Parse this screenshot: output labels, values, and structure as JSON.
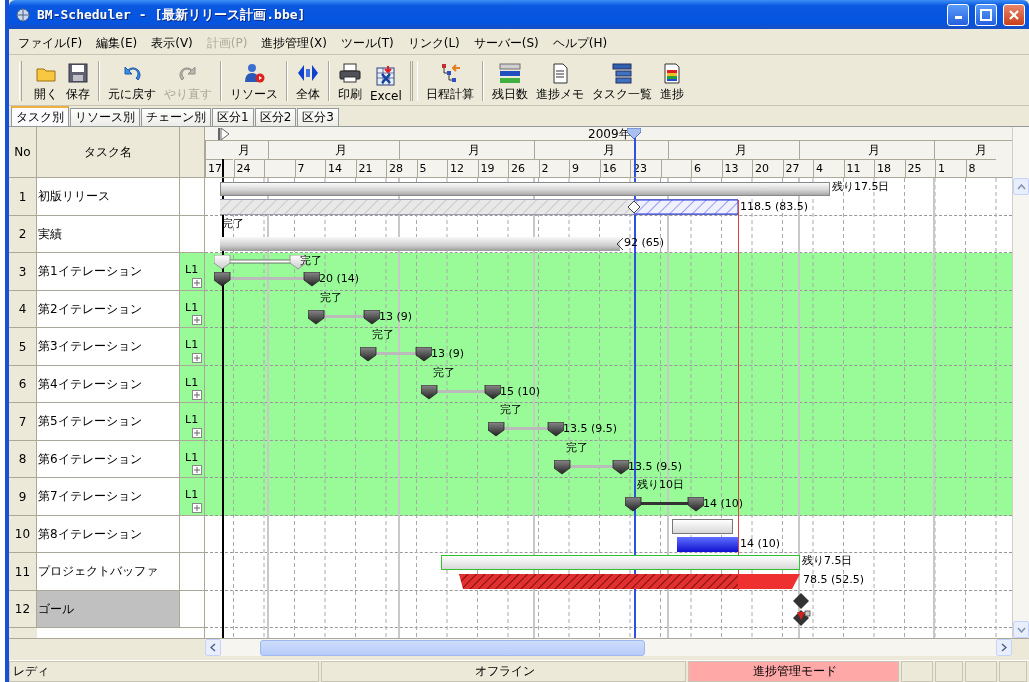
{
  "window": {
    "title": "BM-Scheduler - [最新リリース計画.bbe]"
  },
  "menu": [
    {
      "label": "ファイル(F)",
      "disabled": false
    },
    {
      "label": "編集(E)",
      "disabled": false
    },
    {
      "label": "表示(V)",
      "disabled": false
    },
    {
      "label": "計画(P)",
      "disabled": true
    },
    {
      "label": "進捗管理(X)",
      "disabled": false
    },
    {
      "label": "ツール(T)",
      "disabled": false
    },
    {
      "label": "リンク(L)",
      "disabled": false
    },
    {
      "label": "サーバー(S)",
      "disabled": false
    },
    {
      "label": "ヘルプ(H)",
      "disabled": false
    }
  ],
  "toolbar": [
    [
      {
        "label": "開く",
        "disabled": false
      },
      {
        "label": "保存",
        "disabled": false
      }
    ],
    [
      {
        "label": "元に戻す",
        "disabled": false
      },
      {
        "label": "やり直す",
        "disabled": true
      }
    ],
    [
      {
        "label": "リソース",
        "disabled": false
      }
    ],
    [
      {
        "label": "全体",
        "disabled": false
      }
    ],
    [
      {
        "label": "印刷",
        "disabled": false
      },
      {
        "label": "Excel",
        "disabled": false
      }
    ],
    [
      {
        "label": "日程計算",
        "disabled": false
      }
    ],
    [
      {
        "label": "残日数",
        "disabled": false
      },
      {
        "label": "進捗メモ",
        "disabled": false
      },
      {
        "label": "タスク一覧",
        "disabled": false
      },
      {
        "label": "進捗",
        "disabled": false
      }
    ]
  ],
  "tabs": [
    {
      "label": "タスク別",
      "selected": true
    },
    {
      "label": "リソース別",
      "selected": false
    },
    {
      "label": "チェーン別",
      "selected": false
    },
    {
      "label": "区分1",
      "selected": false
    },
    {
      "label": "区分2",
      "selected": false
    },
    {
      "label": "区分3",
      "selected": false
    }
  ],
  "grid": {
    "columns": [
      "No",
      "タスク名"
    ]
  },
  "timeline": {
    "year": "2009年",
    "months": [
      {
        "label": "月",
        "days": [
          "17",
          "24"
        ]
      },
      {
        "label": "月",
        "days": [
          "7",
          "14",
          "21",
          "28"
        ]
      },
      {
        "label": "月",
        "days": [
          "5",
          "12",
          "19",
          "26"
        ]
      },
      {
        "label": "月",
        "days": [
          "2",
          "9",
          "16",
          "23"
        ]
      },
      {
        "label": "月",
        "days": [
          "6",
          "13",
          "20",
          "27"
        ]
      },
      {
        "label": "月",
        "days": [
          "4",
          "11",
          "18",
          "25"
        ]
      },
      {
        "label": "月",
        "days": [
          "1",
          "8"
        ]
      }
    ]
  },
  "rows": [
    {
      "no": "1",
      "name": "初版リリース",
      "kind": "summary",
      "selected": false,
      "highlighted": false,
      "level": 0.8,
      "status": "残り17.5日",
      "value": "118.5 (83.5)"
    },
    {
      "no": "2",
      "name": "実績",
      "kind": "actual",
      "selected": false,
      "highlighted": false,
      "status": "完了",
      "value": "92 (65)"
    },
    {
      "no": "3",
      "name": "第1イテレーション",
      "kind": "first_iteration",
      "group": "L1",
      "selected": false,
      "highlighted": true,
      "status": "完了",
      "value": "20 (14)"
    },
    {
      "no": "4",
      "name": "第2イテレーション",
      "kind": "iteration",
      "group": "L1",
      "selected": false,
      "highlighted": true,
      "status": "完了",
      "value": "13 (9)"
    },
    {
      "no": "5",
      "name": "第3イテレーション",
      "kind": "iteration",
      "group": "L1",
      "selected": false,
      "highlighted": true,
      "status": "完了",
      "value": "13 (9)"
    },
    {
      "no": "6",
      "name": "第4イテレーション",
      "kind": "iteration",
      "group": "L1",
      "selected": false,
      "highlighted": true,
      "status": "完了",
      "value": "15 (10)"
    },
    {
      "no": "7",
      "name": "第5イテレーション",
      "kind": "iteration",
      "group": "L1",
      "selected": false,
      "highlighted": true,
      "status": "完了",
      "value": "13.5 (9.5)"
    },
    {
      "no": "8",
      "name": "第6イテレーション",
      "kind": "iteration",
      "group": "L1",
      "selected": false,
      "highlighted": true,
      "status": "完了",
      "value": "13.5 (9.5)"
    },
    {
      "no": "9",
      "name": "第7イテレーション",
      "kind": "current",
      "group": "L1",
      "selected": false,
      "highlighted": true,
      "status": "残り10日",
      "value": "14 (10)"
    },
    {
      "no": "10",
      "name": "第8イテレーション",
      "kind": "planned",
      "selected": false,
      "highlighted": false,
      "value": "14 (10)"
    },
    {
      "no": "11",
      "name": "プロジェクトバッファ",
      "kind": "buffer",
      "selected": false,
      "highlighted": false,
      "status": "残り7.5日",
      "value": "78.5 (52.5)"
    },
    {
      "no": "12",
      "name": "ゴール",
      "kind": "goal",
      "selected": true,
      "highlighted": false
    }
  ],
  "status_bar": {
    "left": "レディ",
    "connection": "オフライン",
    "mode": "進捗管理モード"
  }
}
